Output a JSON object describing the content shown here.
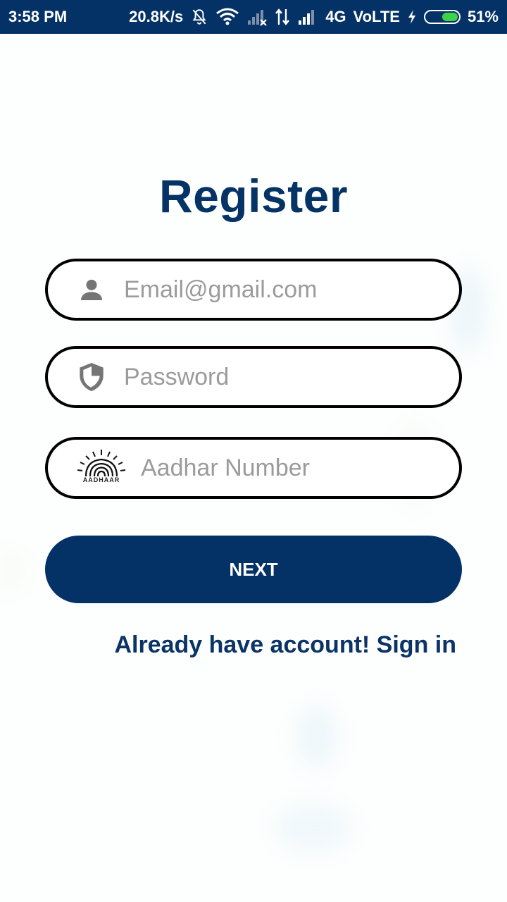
{
  "status_bar": {
    "time": "3:58 PM",
    "speed": "20.8K/s",
    "network": "4G",
    "volte": "VoLTE",
    "battery_percent": "51%",
    "battery_level": 0.51,
    "icons": [
      "bell-off-icon",
      "wifi-icon",
      "signal-x-icon",
      "data-arrows-icon",
      "signal-icon",
      "charging-icon",
      "battery-icon"
    ]
  },
  "form": {
    "title": "Register",
    "email_placeholder": "Email@gmail.com",
    "password_placeholder": "Password",
    "aadhar_placeholder": "Aadhar Number",
    "aadhaar_logo_text": "AADHAAR",
    "next_label": "NEXT",
    "signin_link": "Already have account! Sign in"
  },
  "colors": {
    "primary": "#043266",
    "border": "#000000",
    "placeholder": "#9b9b9b",
    "icon_gray": "#757575",
    "battery_green": "#3ed24a"
  }
}
